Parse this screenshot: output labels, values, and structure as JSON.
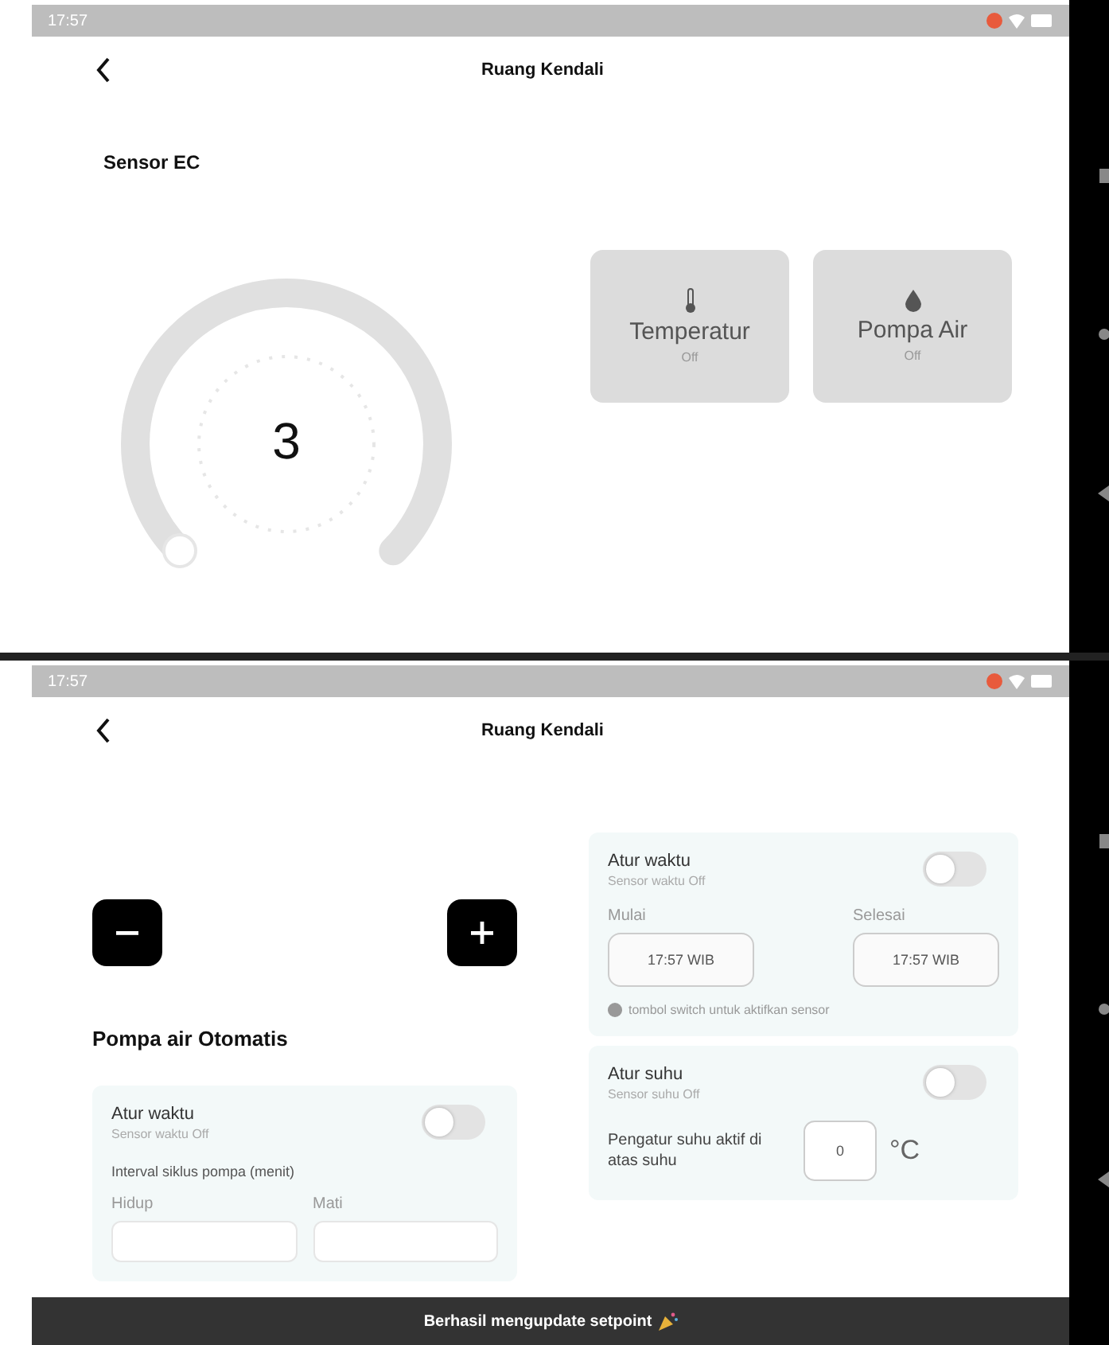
{
  "screen_top": {
    "status_bar": {
      "time": "17:57"
    },
    "app_bar": {
      "title": "Ruang Kendali"
    },
    "section_title": "Sensor EC",
    "gauge": {
      "value": "3"
    },
    "devices": [
      {
        "kind": "thermometer",
        "label": "Temperatur",
        "status": "Off",
        "on": false
      },
      {
        "kind": "drop",
        "label": "Pompa Air",
        "status": "Off",
        "on": false
      }
    ]
  },
  "screen_bottom": {
    "status_bar": {
      "time": "17:57"
    },
    "app_bar": {
      "title": "Ruang Kendali"
    },
    "pump_title": "Pompa air Otomatis",
    "pump_card": {
      "title": "Atur waktu",
      "subtitle": "Sensor waktu Off",
      "on": false,
      "interval_label": "Interval siklus pompa (menit)",
      "fields": [
        {
          "label": "Hidup"
        },
        {
          "label": "Mati"
        }
      ]
    },
    "time_card": {
      "title": "Atur waktu",
      "subtitle": "Sensor waktu Off",
      "on": false,
      "fields": [
        {
          "label": "Mulai",
          "value": "17:57 WIB"
        },
        {
          "label": "Selesai",
          "value": "17:57 WIB"
        }
      ],
      "hint": "tombol switch untuk aktifkan sensor"
    },
    "temp_card": {
      "title": "Atur suhu",
      "subtitle": "Sensor suhu Off",
      "on": false,
      "setting_label": "Pengatur suhu aktif di atas suhu",
      "value": "0",
      "unit": "°C"
    },
    "toast": {
      "text": "Berhasil mengupdate setpoint"
    }
  }
}
